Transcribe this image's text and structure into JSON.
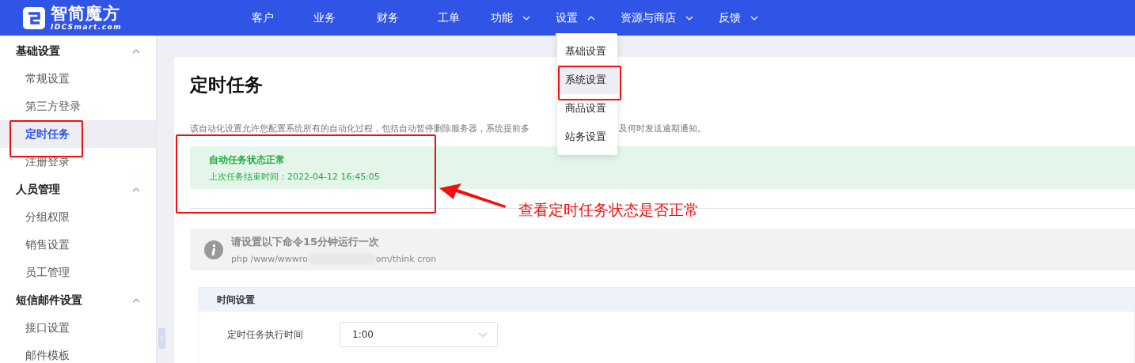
{
  "logo": {
    "name": "智简魔方",
    "domain": "IDCSmart.com"
  },
  "nav": [
    {
      "label": "客户",
      "selected": false,
      "has_menu": false
    },
    {
      "label": "业务",
      "selected": false,
      "has_menu": false
    },
    {
      "label": "财务",
      "selected": false,
      "has_menu": false
    },
    {
      "label": "工单",
      "selected": false,
      "has_menu": false
    },
    {
      "label": "功能",
      "selected": false,
      "has_menu": true,
      "expanded": false
    },
    {
      "label": "设置",
      "selected": true,
      "has_menu": true,
      "expanded": true
    },
    {
      "label": "资源与商店",
      "selected": false,
      "has_menu": true,
      "expanded": false
    },
    {
      "label": "反馈",
      "selected": false,
      "has_menu": true,
      "expanded": false
    }
  ],
  "dropdown": {
    "items": [
      {
        "label": "基础设置",
        "selected": false
      },
      {
        "label": "系统设置",
        "selected": true
      },
      {
        "label": "商品设置",
        "selected": false
      },
      {
        "label": "站务设置",
        "selected": false
      }
    ]
  },
  "sidebar": {
    "groups": [
      {
        "label": "基础设置",
        "expanded": true,
        "children": [
          {
            "label": "常规设置",
            "selected": false
          },
          {
            "label": "第三方登录",
            "selected": false
          },
          {
            "label": "定时任务",
            "selected": true
          },
          {
            "label": "注册登录",
            "selected": false
          }
        ]
      },
      {
        "label": "人员管理",
        "expanded": true,
        "children": [
          {
            "label": "分组权限",
            "selected": false
          },
          {
            "label": "销售设置",
            "selected": false
          },
          {
            "label": "员工管理",
            "selected": false
          }
        ]
      },
      {
        "label": "短信邮件设置",
        "expanded": true,
        "children": [
          {
            "label": "接口设置",
            "selected": false
          },
          {
            "label": "邮件模板",
            "selected": false
          }
        ]
      }
    ]
  },
  "page": {
    "title": "定时任务",
    "description": [
      "该自动化设置允许您配置系统所有的自动化过程，包括自动暂停删除服务器，系统提前多",
      "及何时发送逾期通知。"
    ],
    "status": {
      "title": "自动任务状态正常",
      "detail": "上次任务结束时间：2022-04-12 16:45:05"
    },
    "info": {
      "title": "请设置以下命令15分钟运行一次",
      "command": [
        "php /www/wwwro",
        "om/think cron"
      ]
    },
    "time_settings": {
      "title": "时间设置",
      "field_label": "定时任务执行时间",
      "value": "1:00"
    }
  },
  "annotation": {
    "text": "查看定时任务状态是否正常"
  }
}
